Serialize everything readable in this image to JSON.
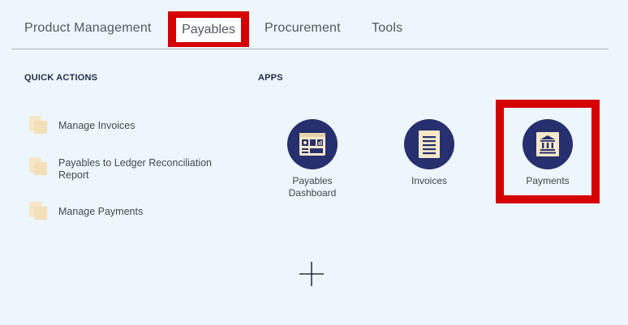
{
  "tabs": [
    {
      "label": "Product Management"
    },
    {
      "label": "Payables"
    },
    {
      "label": "Procurement"
    },
    {
      "label": "Tools"
    }
  ],
  "quick_actions": {
    "title": "QUICK ACTIONS",
    "items": [
      {
        "label": "Manage Invoices"
      },
      {
        "label": "Payables to Ledger Reconciliation Report"
      },
      {
        "label": "Manage Payments"
      }
    ]
  },
  "apps": {
    "title": "APPS",
    "items": [
      {
        "label": "Payables Dashboard",
        "icon": "dashboard-icon"
      },
      {
        "label": "Invoices",
        "icon": "invoice-document-icon"
      },
      {
        "label": "Payments",
        "icon": "bank-building-icon"
      }
    ]
  },
  "colors": {
    "background": "#eef6fd",
    "app_circle": "#26306f",
    "highlight": "#d50000",
    "icon_cream": "#f6e7c8"
  }
}
